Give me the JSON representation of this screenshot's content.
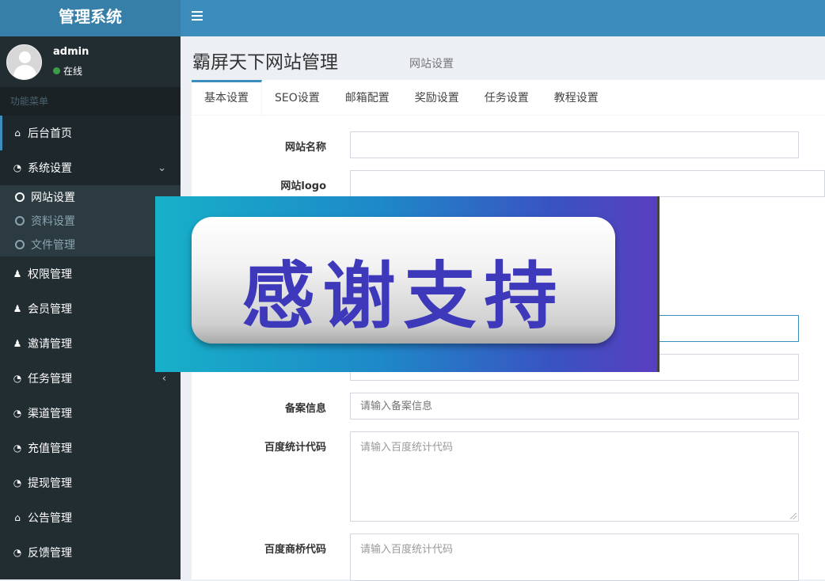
{
  "app": {
    "title": "管理系统"
  },
  "user": {
    "name": "admin",
    "status": "在线"
  },
  "sidebar": {
    "header": "功能菜单",
    "items": [
      {
        "label": "后台首页",
        "icon": "home-icon"
      },
      {
        "label": "系统设置",
        "icon": "dashboard-icon",
        "arrow": "⌄"
      },
      {
        "label": "权限管理",
        "icon": "users-icon"
      },
      {
        "label": "会员管理",
        "icon": "users-icon"
      },
      {
        "label": "邀请管理",
        "icon": "users-icon"
      },
      {
        "label": "任务管理",
        "icon": "dashboard-icon",
        "arrow": "‹"
      },
      {
        "label": "渠道管理",
        "icon": "dashboard-icon"
      },
      {
        "label": "充值管理",
        "icon": "dashboard-icon"
      },
      {
        "label": "提现管理",
        "icon": "dashboard-icon"
      },
      {
        "label": "公告管理",
        "icon": "home-icon"
      },
      {
        "label": "反馈管理",
        "icon": "dashboard-icon"
      }
    ],
    "submenu": [
      {
        "label": "网站设置"
      },
      {
        "label": "资料设置"
      },
      {
        "label": "文件管理"
      }
    ]
  },
  "page": {
    "title": "霸屏天下网站管理",
    "subtitle": "网站设置"
  },
  "tabs": [
    "基本设置",
    "SEO设置",
    "邮箱配置",
    "奖励设置",
    "任务设置",
    "教程设置"
  ],
  "form": {
    "site_name_label": "网站名称",
    "site_logo_label": "网站logo",
    "beian_label": "备案信息",
    "beian_placeholder": "请输入备案信息",
    "baidu_stats_label": "百度统计代码",
    "baidu_stats_placeholder": "请输入百度统计代码",
    "baidu_bridge_label": "百度商桥代码",
    "baidu_bridge_placeholder": "请输入百度统计代码"
  },
  "banner": {
    "text": "感谢支持"
  },
  "colors": {
    "sidebar": "#222d32",
    "topbar": "#3c8dbc",
    "logo": "#367fa9",
    "accent": "#3c8dbc"
  }
}
